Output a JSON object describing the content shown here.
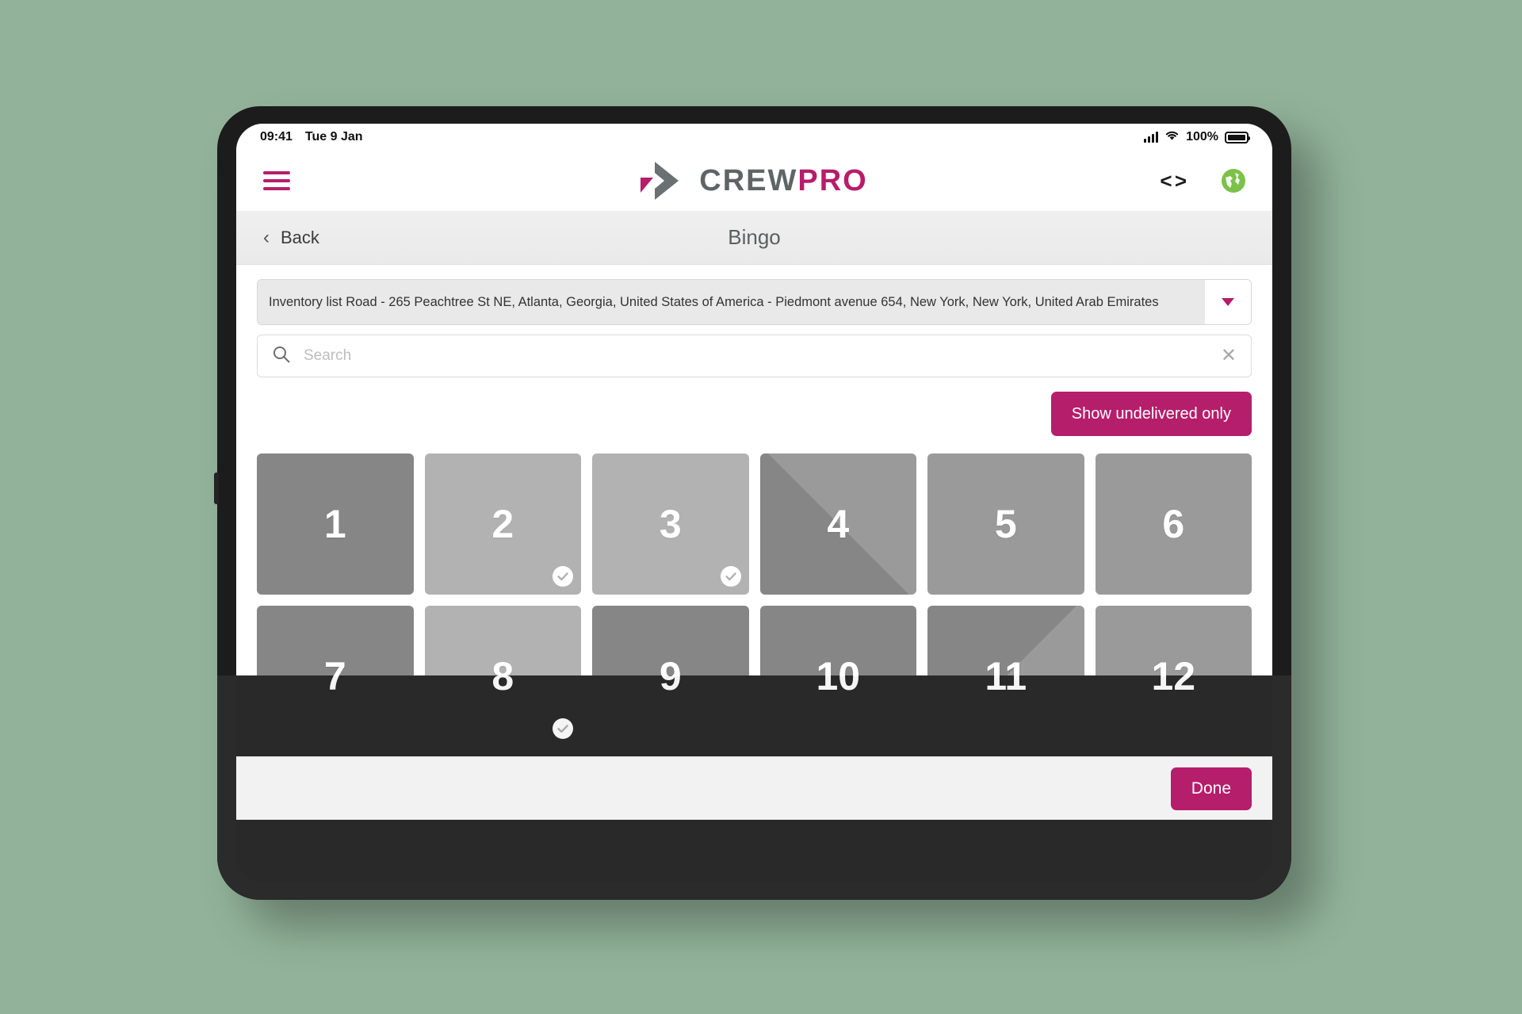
{
  "status_bar": {
    "time": "09:41",
    "date": "Tue 9 Jan",
    "battery_percent": "100%",
    "signal_icon": "cellular-bars-icon",
    "wifi_icon": "wifi-icon",
    "battery_icon": "battery-full-icon"
  },
  "header": {
    "menu_icon": "hamburger-menu-icon",
    "logo_text_primary": "CREW",
    "logo_text_secondary": "PRO",
    "code_icon_label": "< >",
    "globe_icon": "globe-icon"
  },
  "sub_header": {
    "back_label": "Back",
    "back_chevron": "‹",
    "title": "Bingo"
  },
  "address": {
    "value": "Inventory list Road - 265 Peachtree St NE, Atlanta, Georgia, United States of America - Piedmont avenue 654, New York, New York, United Arab Emirates",
    "caret_icon": "chevron-down-icon"
  },
  "search": {
    "placeholder": "Search",
    "value": "",
    "search_icon": "search-icon",
    "clear_icon": "close-icon",
    "clear_glyph": "✕"
  },
  "filter": {
    "undelivered_label": "Show undelivered only"
  },
  "footer": {
    "done_label": "Done"
  },
  "colors": {
    "brand_magenta": "#b51e6b",
    "logo_gray": "#5f6467",
    "globe_green": "#7cc24a",
    "tile_dark": "#868686",
    "tile_light": "#b2b2b2",
    "tile_mid": "#9a9a9a"
  },
  "tiles": [
    {
      "label": "1",
      "style": "dark",
      "delivered": false
    },
    {
      "label": "2",
      "style": "light",
      "delivered": true
    },
    {
      "label": "3",
      "style": "light",
      "delivered": true
    },
    {
      "label": "4",
      "style": "diag-tl",
      "delivered": false
    },
    {
      "label": "5",
      "style": "mid",
      "delivered": false
    },
    {
      "label": "6",
      "style": "mid",
      "delivered": false
    },
    {
      "label": "7",
      "style": "dark",
      "delivered": false
    },
    {
      "label": "8",
      "style": "light",
      "delivered": true
    },
    {
      "label": "9",
      "style": "dark",
      "delivered": false
    },
    {
      "label": "10",
      "style": "dark",
      "delivered": false
    },
    {
      "label": "11",
      "style": "diag-br",
      "delivered": false
    },
    {
      "label": "12",
      "style": "diag-corner",
      "delivered": false
    }
  ]
}
